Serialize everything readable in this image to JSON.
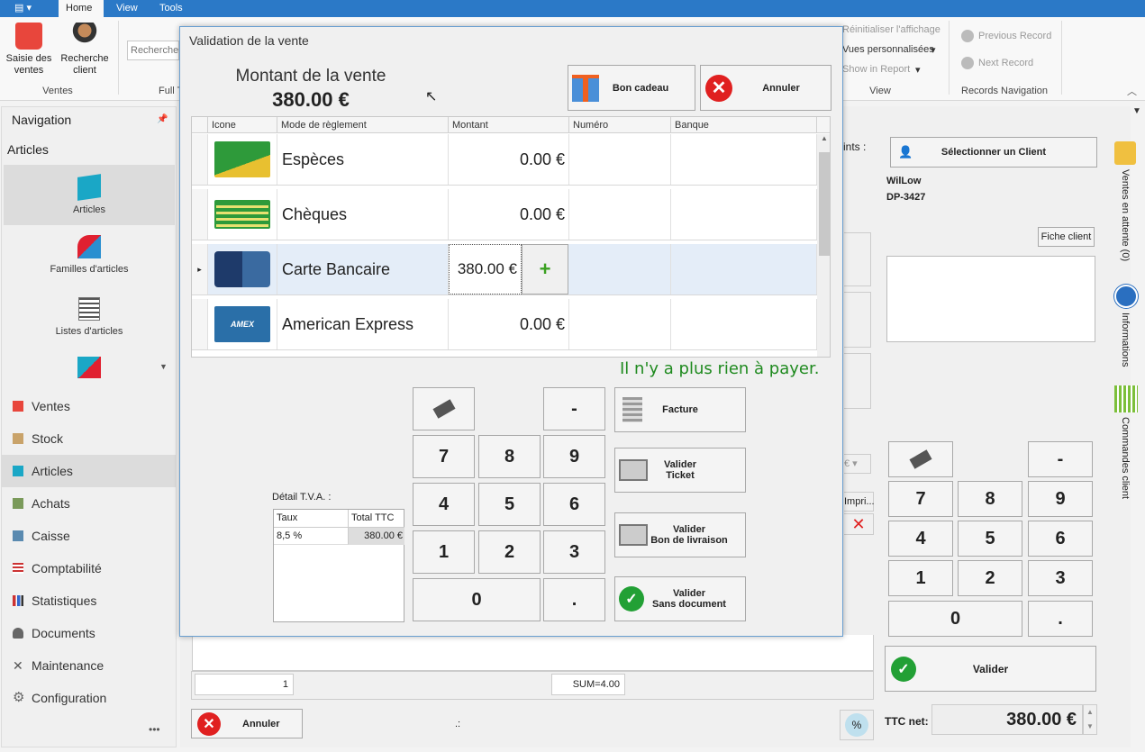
{
  "ribbon": {
    "tabs": [
      "Home",
      "View",
      "Tools"
    ],
    "saisie": "Saisie des ventes",
    "recherche": "Recherche client",
    "search_placeholder": "Recherche",
    "group_ventes": "Ventes",
    "group_full": "Full T",
    "reset_display": "Réinitialiser l'affichage",
    "custom_views": "Vues personnalisées",
    "show_report": "Show in Report",
    "group_view": "View",
    "previous_record": "Previous Record",
    "next_record": "Next Record",
    "group_records": "Records Navigation"
  },
  "navigation": {
    "title": "Navigation",
    "section": "Articles",
    "tiles": [
      "Articles",
      "Familles d'articles",
      "Listes d'articles"
    ],
    "items": [
      "Ventes",
      "Stock",
      "Articles",
      "Achats",
      "Caisse",
      "Comptabilité",
      "Statistiques",
      "Documents",
      "Maintenance",
      "Configuration"
    ],
    "more": "•••"
  },
  "dialog": {
    "title": "Validation de la vente",
    "amount_label": "Montant de la vente",
    "amount": "380.00 €",
    "gift_button": "Bon cadeau",
    "cancel_button": "Annuler",
    "columns": [
      "Icone",
      "Mode de règlement",
      "Montant",
      "Numéro",
      "Banque"
    ],
    "rows": [
      {
        "mode": "Espèces",
        "amount": "0.00 €"
      },
      {
        "mode": "Chèques",
        "amount": "0.00 €"
      },
      {
        "mode": "Carte Bancaire",
        "amount": "380.00 €"
      },
      {
        "mode": "American Express",
        "amount": "0.00 €"
      }
    ],
    "status": "Il n'y a plus rien à payer.",
    "tva_label": "Détail T.V.A. :",
    "tva_cols": [
      "Taux",
      "Total TTC"
    ],
    "tva_row": [
      "8,5 %",
      "380.00 €"
    ],
    "keys": [
      "-",
      "7",
      "8",
      "9",
      "4",
      "5",
      "6",
      "1",
      "2",
      "3",
      "0",
      "."
    ],
    "facture": "Facture",
    "valider_ticket": "Valider\nTicket",
    "valider_livraison": "Valider\nBon de livraison",
    "valider_sans": "Valider\nSans document"
  },
  "right": {
    "select_client": "Sélectionner un Client",
    "client_name": "WilLow",
    "client_code": "DP-3427",
    "fiche": "Fiche client",
    "keys": [
      "-",
      "7",
      "8",
      "9",
      "4",
      "5",
      "6",
      "1",
      "2",
      "3",
      "0",
      "."
    ],
    "valider": "Valider",
    "ttc_label": "TTC net:",
    "ttc_value": "380.00 €",
    "points": "ints :",
    "side_tabs": [
      "Ventes en attente (0)",
      "Informations",
      "Commandes client"
    ],
    "euro": "€",
    "print": "Impri..."
  },
  "bottom": {
    "qty": "1",
    "sum": "SUM=4.00",
    "cancel": "Annuler",
    "dots": ".:",
    "percent": "%"
  },
  "colors": {
    "accent": "#2b79c7",
    "status": "#1f8a1f"
  }
}
